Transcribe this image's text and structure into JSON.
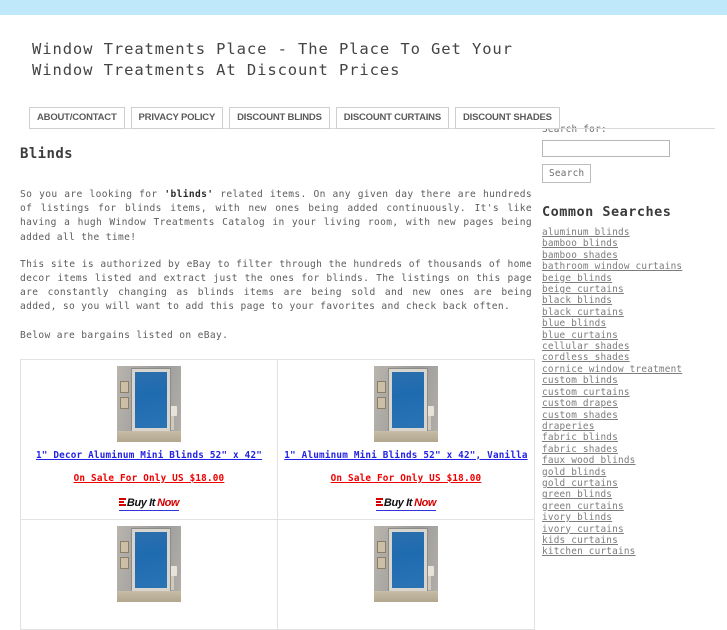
{
  "topbar": {
    "color": "#bfe9fb"
  },
  "header": {
    "site_title": "Window Treatments Place - The Place To Get Your Window Treatments At Discount Prices"
  },
  "nav": {
    "tabs": [
      {
        "label": "ABOUT/CONTACT"
      },
      {
        "label": "PRIVACY POLICY"
      },
      {
        "label": "DISCOUNT BLINDS"
      },
      {
        "label": "DISCOUNT CURTAINS"
      },
      {
        "label": "DISCOUNT SHADES"
      }
    ]
  },
  "main": {
    "heading": "Blinds",
    "paragraph1_pre": "So you are looking for ",
    "paragraph1_bold": "'blinds'",
    "paragraph1_post": " related items. On any given day there are hundreds of listings for blinds items, with new ones being added continuously. It's like having a hugh Window Treatments Catalog in your living room, with new pages being added all the time!",
    "paragraph2": "This site is authorized by eBay to filter through the hundreds of thousands of home decor items listed and extract just the ones for blinds. The listings on this page are constantly changing as blinds items are being sold and new ones are being added, so you will want to add this page to your favorites and check back often.",
    "below_note": "Below are bargains listed on eBay.",
    "listings": [
      {
        "title": "1\" Decor Aluminum Mini Blinds 52\" x 42\"",
        "price": "On Sale For Only US $18.00",
        "buy_bars": "bin-bars-icon",
        "buy_label_dark": "Buy It",
        "buy_label_red": "Now"
      },
      {
        "title": "1\" Aluminum Mini Blinds 52\" x 42\", Vanilla",
        "price": "On Sale For Only US $18.00",
        "buy_bars": "bin-bars-icon",
        "buy_label_dark": "Buy It",
        "buy_label_red": "Now"
      },
      {
        "title": "",
        "price": "",
        "buy_label_dark": "",
        "buy_label_red": ""
      },
      {
        "title": "",
        "price": "",
        "buy_label_dark": "",
        "buy_label_red": ""
      }
    ]
  },
  "sidebar": {
    "search_label": "Search for:",
    "search_value": "",
    "search_placeholder": "",
    "search_button": "Search",
    "common_heading": "Common Searches",
    "links": [
      {
        "label": "aluminum blinds"
      },
      {
        "label": "bamboo blinds"
      },
      {
        "label": "bamboo shades"
      },
      {
        "label": "bathroom window curtains"
      },
      {
        "label": "beige blinds"
      },
      {
        "label": "beige curtains"
      },
      {
        "label": "black blinds"
      },
      {
        "label": "black curtains"
      },
      {
        "label": "blue blinds"
      },
      {
        "label": "blue curtains"
      },
      {
        "label": "cellular shades"
      },
      {
        "label": "cordless shades"
      },
      {
        "label": "cornice window treatment"
      },
      {
        "label": "custom blinds"
      },
      {
        "label": "custom curtains"
      },
      {
        "label": "custom drapes"
      },
      {
        "label": "custom shades"
      },
      {
        "label": "draperies"
      },
      {
        "label": "fabric blinds"
      },
      {
        "label": "fabric shades"
      },
      {
        "label": "faux wood blinds"
      },
      {
        "label": "gold blinds"
      },
      {
        "label": "gold curtains"
      },
      {
        "label": "green blinds"
      },
      {
        "label": "green curtains"
      },
      {
        "label": "ivory blinds"
      },
      {
        "label": "ivory curtains"
      },
      {
        "label": "kids curtains"
      },
      {
        "label": "kitchen curtains"
      }
    ]
  }
}
